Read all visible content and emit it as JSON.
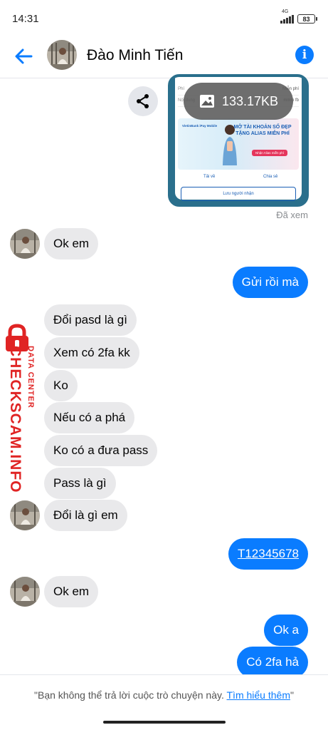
{
  "status_bar": {
    "time": "14:31",
    "network": "4G",
    "battery": "83"
  },
  "header": {
    "contact_name": "Đào Minh Tiến",
    "back_icon": "arrow-left-icon",
    "info_icon": "info-icon",
    "info_glyph": "i",
    "accent_color": "#0a7cff"
  },
  "image_message": {
    "file_size": "133.17KB",
    "image_icon": "image-icon",
    "share_icon": "share-icon",
    "seen_label": "Đã xem",
    "preview": {
      "row1_label": "Phí",
      "row1_value": "Miễn phí",
      "row2_label": "Nội dung",
      "row2_value": "mmm fb",
      "banner_logo": "VietinBank iPay Mobile",
      "banner_title": "MỞ TÀI KHOẢN SỐ ĐẸP TẶNG ALIAS MIỄN PHÍ",
      "banner_button": "Nhận Alias miễn phí",
      "download_label": "Tải về",
      "share_label": "Chia sẻ",
      "save_label": "Lưu người nhận"
    }
  },
  "messages": [
    {
      "side": "in",
      "text": "Ok em"
    },
    {
      "side": "out",
      "text": "Gửi rồi mà"
    },
    {
      "side": "in",
      "text": "Đổi pasd là gì"
    },
    {
      "side": "in",
      "text": "Xem có 2fa kk"
    },
    {
      "side": "in",
      "text": "Ko"
    },
    {
      "side": "in",
      "text": "Nếu có a phá"
    },
    {
      "side": "in",
      "text": "Ko có a đưa pass"
    },
    {
      "side": "in",
      "text": "Pass là gì"
    },
    {
      "side": "in",
      "text": "Đổi là gì em"
    },
    {
      "side": "out",
      "text": "T12345678"
    },
    {
      "side": "in",
      "text": "Ok em"
    },
    {
      "side": "out",
      "text": "Ok a"
    },
    {
      "side": "out",
      "text": "Có 2fa hả"
    }
  ],
  "watermark": {
    "main": "CHECKSCAM.INFO",
    "sub": "DATA CENTER",
    "icon": "lock-icon",
    "color": "#e02424"
  },
  "footer": {
    "notice": "\"Bạn không thể trả lời cuộc trò chuyện này. ",
    "link": "Tìm hiểu thêm",
    "close_quote": "\""
  }
}
